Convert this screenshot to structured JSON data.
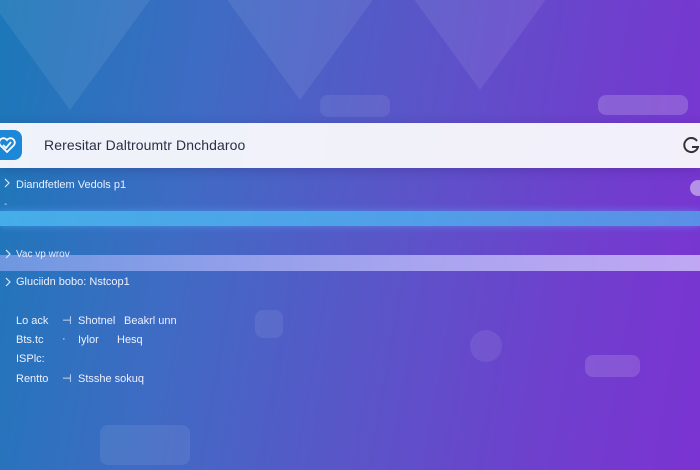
{
  "header": {
    "title": "Reresitar Daltroumtr Dnchdaroo"
  },
  "subheader": {
    "text": "Diandfetlem Vedols p1"
  },
  "row_small": {
    "text": "Vac vp wrov"
  },
  "info_row": {
    "text": "Gluciidn bobo: Nstcop1"
  },
  "details": [
    {
      "key": "Lo ack",
      "sep": "⊣",
      "value": "Shotnel",
      "value2": "Beakrl unn"
    },
    {
      "key": "Bts.tc",
      "sep": "·",
      "value": "Iylor",
      "value2": "Hesq"
    },
    {
      "key": "ISPlc:",
      "sep": "",
      "value": "",
      "value2": ""
    },
    {
      "key": "Rentto",
      "sep": "⊣",
      "value": "Stsshe sokuq",
      "value2": ""
    }
  ],
  "colors": {
    "accent": "#1d88d8",
    "bar": "#4fa2e8"
  },
  "icons": {
    "logo": "heart-check-icon",
    "header_right": "g-circle-icon",
    "row_chevron": "diamond-chevron-icon"
  }
}
